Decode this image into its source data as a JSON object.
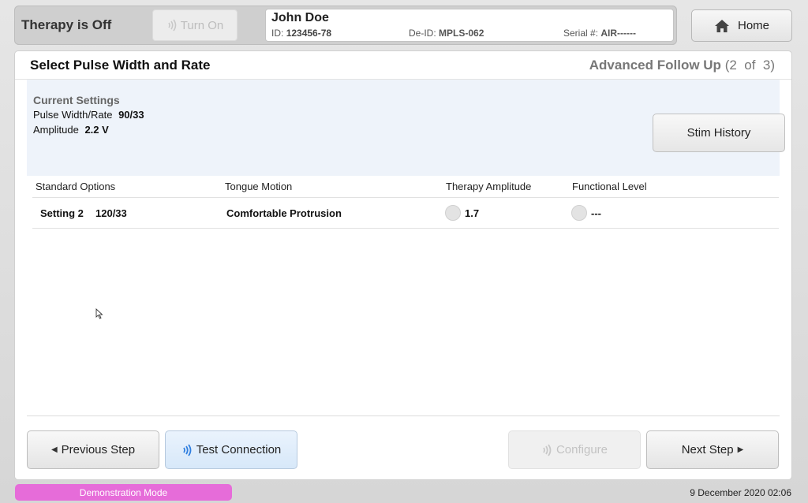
{
  "top_bar": {
    "therapy_status": "Therapy is Off",
    "turn_on_label": "Turn On"
  },
  "patient": {
    "name": "John Doe",
    "id_label": "ID:",
    "id_value": "123456-78",
    "deid_label": "De-ID:",
    "deid_value": "MPLS-062",
    "serial_label": "Serial #:",
    "serial_value": "AIR------"
  },
  "home_label": "Home",
  "page": {
    "title": "Select Pulse Width and Rate",
    "step_name": "Advanced Follow Up",
    "step_progress": "(2  of  3)"
  },
  "current_settings": {
    "title": "Current Settings",
    "pulse_label": "Pulse Width/Rate",
    "pulse_value": "90/33",
    "amplitude_label": "Amplitude",
    "amplitude_value": "2.2 V",
    "stim_history_label": "Stim History"
  },
  "table": {
    "headers": [
      "Standard Options",
      "Tongue Motion",
      "Therapy Amplitude",
      "Functional Level"
    ],
    "rows": [
      {
        "setting": "Setting 2",
        "pulse_rate": "120/33",
        "tongue_motion": "Comfortable Protrusion",
        "therapy_amplitude": "1.7",
        "functional_level": "---"
      }
    ]
  },
  "footer_buttons": {
    "previous": "Previous Step",
    "test_connection": "Test Connection",
    "configure": "Configure",
    "next": "Next Step"
  },
  "status": {
    "mode": "Demonstration Mode",
    "datetime": "9 December 2020 02:06"
  },
  "colors": {
    "demo_badge": "#e66cd9",
    "signal_active": "#2f7fe0",
    "signal_disabled": "#c8c8c8",
    "current_settings_bg": "#eef3fa"
  }
}
